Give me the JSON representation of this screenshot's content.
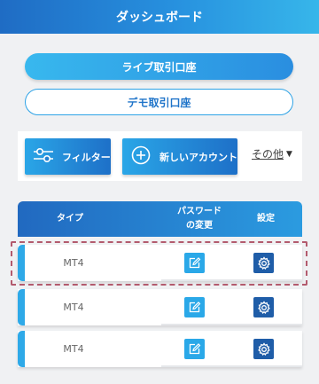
{
  "header": {
    "title": "ダッシュボード"
  },
  "account_tabs": {
    "live_label": "ライブ取引口座",
    "demo_label": "デモ取引口座"
  },
  "toolbar": {
    "filter_label": "フィルター",
    "new_account_label": "新しいアカウント",
    "more_label": "その他"
  },
  "table": {
    "headers": {
      "type": "タイプ",
      "password_line1": "パスワード",
      "password_line2": "の変更",
      "settings": "設定"
    },
    "rows": [
      {
        "type": "MT4"
      },
      {
        "type": "MT4"
      },
      {
        "type": "MT4"
      }
    ]
  },
  "colors": {
    "accent_blue": "#2aa8e8",
    "dark_blue": "#1f5da8",
    "highlight": "#b35b6e"
  },
  "icons": {
    "filter": "sliders-icon",
    "new_account": "plus-circle-icon",
    "more": "caret-down-icon",
    "password": "edit-icon",
    "settings": "gear-icon"
  }
}
